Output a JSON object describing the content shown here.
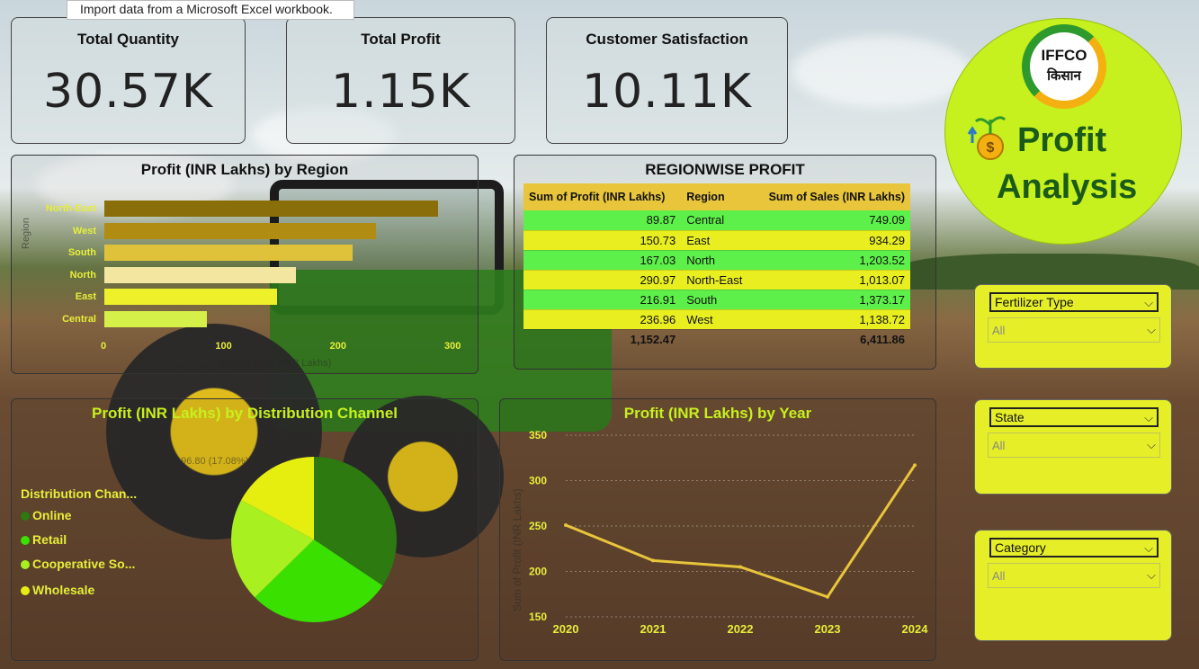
{
  "tooltip": "Import data from a Microsoft Excel workbook.",
  "kpis": [
    {
      "title": "Total Quantity",
      "value": "30.57K"
    },
    {
      "title": "Total Profit",
      "value": "1.15K"
    },
    {
      "title": "Customer Satisfaction",
      "value": "10.11K"
    }
  ],
  "brand": {
    "logo_top": "IFFCO",
    "logo_bottom": "किसान",
    "title_line1": "Profit",
    "title_line2": "Analysis",
    "color": "#c6f01e"
  },
  "slicers": [
    {
      "label": "Fertilizer Type",
      "value": "All"
    },
    {
      "label": "State",
      "value": "All"
    },
    {
      "label": "Category",
      "value": "All"
    }
  ],
  "table": {
    "title": "REGIONWISE PROFIT",
    "headers": [
      "Sum of Profit (INR Lakhs)",
      "Region",
      "Sum of Sales (INR Lakhs)"
    ],
    "rows": [
      [
        "89.87",
        "Central",
        "749.09"
      ],
      [
        "150.73",
        "East",
        "934.29"
      ],
      [
        "167.03",
        "North",
        "1,203.52"
      ],
      [
        "290.97",
        "North-East",
        "1,013.07"
      ],
      [
        "216.91",
        "South",
        "1,373.17"
      ],
      [
        "236.96",
        "West",
        "1,138.72"
      ]
    ],
    "total": [
      "1,152.47",
      "",
      "6,411.86"
    ]
  },
  "chart_data": [
    {
      "type": "bar",
      "title": "Profit (INR Lakhs) by Region",
      "orientation": "horizontal",
      "categories": [
        "North-East",
        "West",
        "South",
        "North",
        "East",
        "Central"
      ],
      "values": [
        290.97,
        236.96,
        216.91,
        167.03,
        150.73,
        89.87
      ],
      "colors": [
        "#8a6e0a",
        "#b08c12",
        "#e0c23a",
        "#f2e6a0",
        "#eef02a",
        "#d6f04a"
      ],
      "xticks": [
        "0",
        "100",
        "200",
        "300"
      ],
      "xlim": [
        0,
        320
      ],
      "xlabel": "Sum of Profit (INR Lakhs)",
      "ylabel": "Region"
    },
    {
      "type": "pie",
      "title": "Profit (INR Lakhs) by Distribution Channel",
      "legend_title": "Distribution Chan...",
      "labels": [
        "Online",
        "Retail",
        "Cooperative So...",
        "Wholesale"
      ],
      "colors": [
        "#2c7a10",
        "#3ae000",
        "#a8f020",
        "#e6ee10"
      ],
      "values": [
        396.6,
        325.6,
        233.5,
        196.8
      ],
      "visible_data_label": "196.80 (17.08%)"
    },
    {
      "type": "line",
      "title": "Profit (INR Lakhs) by Year",
      "x": [
        "2020",
        "2021",
        "2022",
        "2023",
        "2024"
      ],
      "y": [
        251,
        212,
        205,
        172,
        317
      ],
      "ylim": [
        150,
        350
      ],
      "yticks": [
        "150",
        "200",
        "250",
        "300",
        "350"
      ],
      "xlabel": "",
      "ylabel": "Sum of Profit (INR Lakhs)",
      "line_color": "#e8c53a"
    }
  ]
}
